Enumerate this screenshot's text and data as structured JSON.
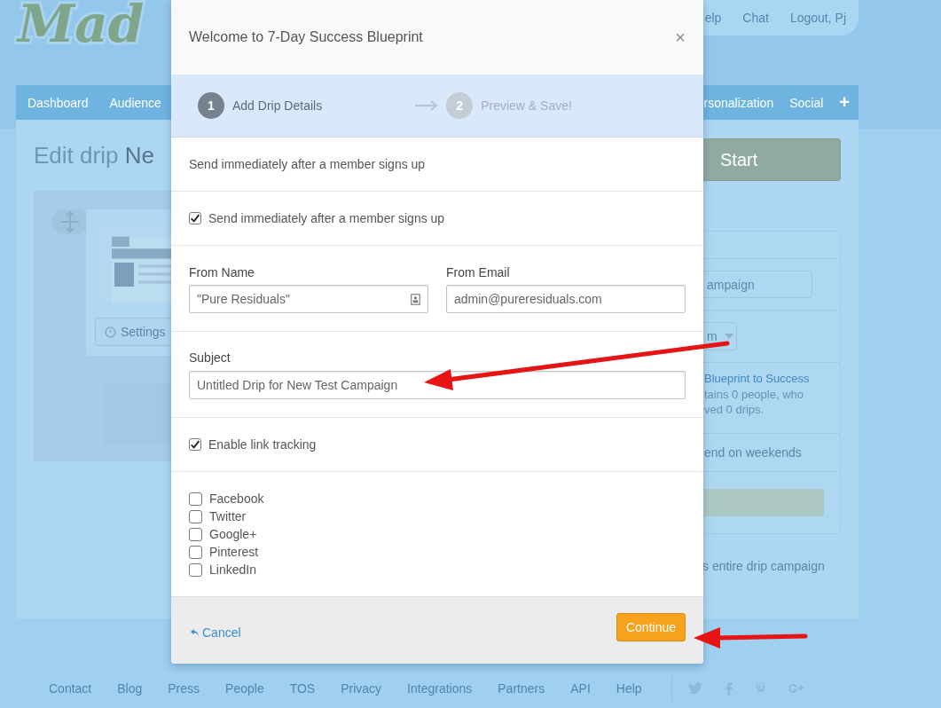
{
  "background": {
    "logo": "Mad",
    "top_nav": [
      "elp",
      "Chat",
      "Logout, Pj"
    ],
    "nav_left": [
      "Dashboard",
      "Audience"
    ],
    "nav_right": [
      "rsonalization",
      "Social",
      "+"
    ],
    "title_light": "Edit drip",
    "title_dark": "Ne",
    "settings_button": "Settings",
    "start_button": "Start",
    "campaign_field": "ampaign",
    "dropdown": "m",
    "list_link": "Blueprint to Success",
    "list_info": "tains 0 people, who\nved 0 drips.",
    "weekends": "end on weekends",
    "note": "s entire drip campaign"
  },
  "footer": {
    "links": [
      "Contact",
      "Blog",
      "Press",
      "People",
      "TOS",
      "Privacy",
      "Integrations",
      "Partners",
      "API",
      "Help"
    ]
  },
  "modal": {
    "title": "Welcome to 7-Day Success Blueprint",
    "close": "×",
    "steps": [
      {
        "number": "1",
        "label": "Add Drip Details",
        "selected": true
      },
      {
        "number": "2",
        "label": "Preview & Save!",
        "selected": false
      }
    ],
    "trigger_text": "Send immediately after a member signs up",
    "send_immediately": {
      "label": "Send immediately after a member signs up",
      "checked": true
    },
    "from_name": {
      "label": "From Name",
      "value": "\"Pure Residuals\""
    },
    "from_email": {
      "label": "From Email",
      "value": "admin@pureresiduals.com"
    },
    "subject": {
      "label": "Subject",
      "value": "Untitled Drip for New Test Campaign"
    },
    "link_tracking": {
      "label": "Enable link tracking",
      "checked": true
    },
    "social": [
      {
        "label": "Facebook",
        "checked": false
      },
      {
        "label": "Twitter",
        "checked": false
      },
      {
        "label": "Google+",
        "checked": false
      },
      {
        "label": "Pinterest",
        "checked": false
      },
      {
        "label": "LinkedIn",
        "checked": false
      }
    ],
    "cancel": "Cancel",
    "continue": "Continue"
  }
}
